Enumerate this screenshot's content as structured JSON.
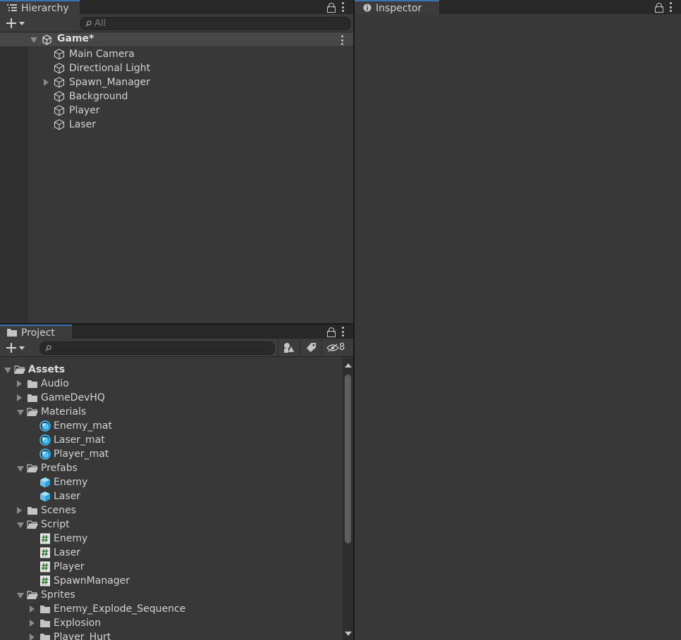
{
  "colors": {
    "panel_bg": "#383838",
    "header_bg": "#282828",
    "tab_bg": "#3c3c3c",
    "material_icon": "#4fc3f7",
    "prefab_icon": "#5ec4f0",
    "script_icon": "#4caf50"
  },
  "hierarchy": {
    "tab_label": "Hierarchy",
    "tab_icon": "list-icon",
    "search_placeholder": "All",
    "scene": {
      "name": "Game*",
      "icon": "unity-scene-icon"
    },
    "objects": [
      {
        "label": "Main Camera",
        "icon": "gameobject-cube-icon",
        "expandable": false
      },
      {
        "label": "Directional Light",
        "icon": "gameobject-cube-icon",
        "expandable": false
      },
      {
        "label": "Spawn_Manager",
        "icon": "gameobject-cube-icon",
        "expandable": true
      },
      {
        "label": "Background",
        "icon": "gameobject-cube-icon",
        "expandable": false
      },
      {
        "label": "Player",
        "icon": "gameobject-cube-icon",
        "expandable": false
      },
      {
        "label": "Laser",
        "icon": "gameobject-cube-icon",
        "expandable": false
      }
    ]
  },
  "project": {
    "tab_label": "Project",
    "tab_icon": "folder-icon",
    "search_placeholder": "",
    "hidden_count": "8",
    "tree": [
      {
        "label": "Assets",
        "type": "folder-open",
        "depth": 0,
        "arrow": "down",
        "bold": true
      },
      {
        "label": "Audio",
        "type": "folder",
        "depth": 1,
        "arrow": "right"
      },
      {
        "label": "GameDevHQ",
        "type": "folder",
        "depth": 1,
        "arrow": "right"
      },
      {
        "label": "Materials",
        "type": "folder-open",
        "depth": 1,
        "arrow": "down"
      },
      {
        "label": "Enemy_mat",
        "type": "material",
        "depth": 2
      },
      {
        "label": "Laser_mat",
        "type": "material",
        "depth": 2
      },
      {
        "label": "Player_mat",
        "type": "material",
        "depth": 2
      },
      {
        "label": "Prefabs",
        "type": "folder-open",
        "depth": 1,
        "arrow": "down"
      },
      {
        "label": "Enemy",
        "type": "prefab",
        "depth": 2
      },
      {
        "label": "Laser",
        "type": "prefab",
        "depth": 2
      },
      {
        "label": "Scenes",
        "type": "folder",
        "depth": 1,
        "arrow": "right"
      },
      {
        "label": "Script",
        "type": "folder-open",
        "depth": 1,
        "arrow": "down"
      },
      {
        "label": "Enemy",
        "type": "script",
        "depth": 2
      },
      {
        "label": "Laser",
        "type": "script",
        "depth": 2
      },
      {
        "label": "Player",
        "type": "script",
        "depth": 2
      },
      {
        "label": "SpawnManager",
        "type": "script",
        "depth": 2
      },
      {
        "label": "Sprites",
        "type": "folder-open",
        "depth": 1,
        "arrow": "down"
      },
      {
        "label": "Enemy_Explode_Sequence",
        "type": "folder",
        "depth": 2,
        "arrow": "right"
      },
      {
        "label": "Explosion",
        "type": "folder",
        "depth": 2,
        "arrow": "right"
      },
      {
        "label": "Player_Hurt",
        "type": "folder",
        "depth": 2,
        "arrow": "right"
      }
    ]
  },
  "inspector": {
    "tab_label": "Inspector",
    "tab_icon": "info-icon"
  }
}
